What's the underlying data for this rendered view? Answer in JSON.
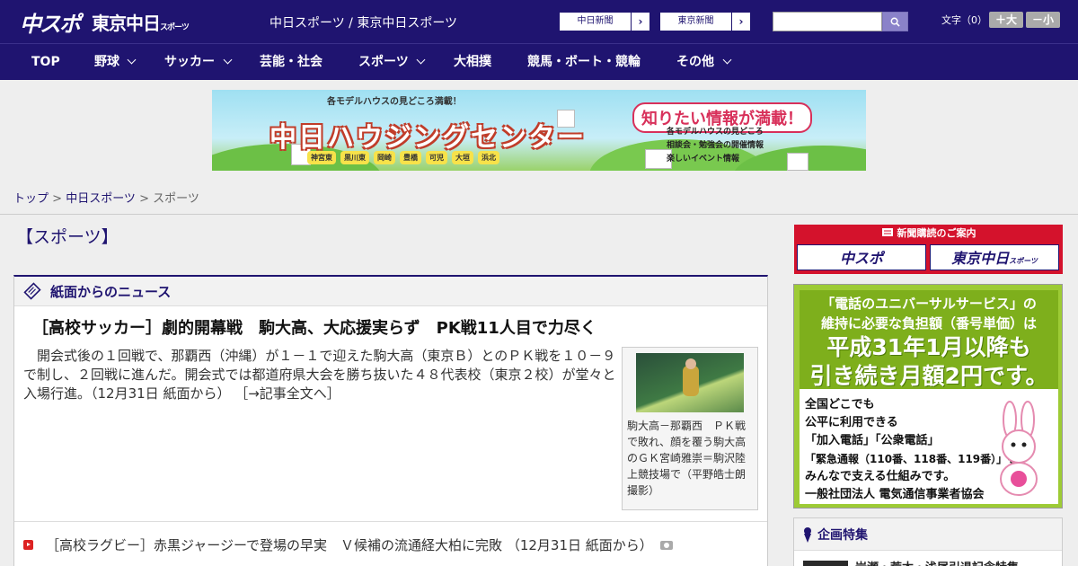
{
  "header": {
    "logo_main": "中スポ",
    "logo_sub": "東京中日",
    "logo_sub_small": "スポーツ",
    "site_names": "中日スポーツ / 東京中日スポーツ",
    "paper_links": [
      "中日新聞",
      "東京新聞"
    ],
    "font_size_label": "文字（0）",
    "font_up": "＋大",
    "font_down": "－小"
  },
  "nav": {
    "items": [
      "TOP",
      "野球",
      "サッカー",
      "芸能・社会",
      "スポーツ",
      "大相撲",
      "競馬・ボート・競輪",
      "その他"
    ]
  },
  "banner": {
    "top_text": "各モデルハウスの見どころ満載！",
    "title": "中日ハウジングセンター",
    "tag": "知りたい情報が満載！",
    "towns": [
      "神宮東",
      "黒川東",
      "岡崎",
      "豊橋",
      "可児",
      "大垣",
      "浜北"
    ],
    "info": [
      "各モデルハウスの見どころ",
      "相談会・勉強会の開催情報",
      "楽しいイベント情報"
    ]
  },
  "breadcrumb": {
    "home": "トップ",
    "parent": "中日スポーツ",
    "current": "スポーツ",
    "sep": " > "
  },
  "page_title": "【スポーツ】",
  "panel": {
    "heading": "紙面からのニュース",
    "lead_title": "［高校サッカー］劇的開幕戦　駒大高、大応援実らず　PK戦11人目で力尽く",
    "lead_body": "開会式後の１回戦で、那覇西（沖縄）が１－１で迎えた駒大高（東京Ｂ）とのＰＫ戦を１０－９で制し、２回戦に進んだ。開会式では都道府県大会を勝ち抜いた４８代表校（東京２校）が堂々と入場行進。（12月31日 紙面から）",
    "lead_link": "［→記事全文へ］",
    "photo_caption": "駒大高－那覇西　ＰＫ戦で敗れ、顔を覆う駒大高のＧＫ宮崎雅崇＝駒沢陸上競技場で（平野皓士朗撮影）",
    "list_item": "［高校ラグビー］赤黒ジャージーで登場の早実　Ｖ候補の流通経大柏に完敗 （12月31日 紙面から）"
  },
  "sidebar": {
    "subscribe_head": "新聞購読のご案内",
    "subscribe_buttons": [
      "中スポ",
      "東京中日"
    ],
    "subscribe_small": "スポーツ",
    "ad_lines": [
      "「電話のユニバーサルサービス」の",
      "維持に必要な負担額（番号単価）は",
      "平成31年1月以降も",
      "引き続き月額2円です。"
    ],
    "ad_body": [
      "全国どこでも",
      "公平に利用できる",
      "「加入電話」「公衆電話」",
      "「緊急通報（110番、118番、119番）」を",
      "みんなで支える仕組みです。",
      "一般社団法人 電気通信事業者協会"
    ],
    "feature_head": "企画特集",
    "feature_item": "岩瀬・荒木・浅尾引退記念特集"
  },
  "colors": {
    "brand_navy": "#1f1470",
    "subscribe_red": "#d4122c",
    "ad_green": "#9dcb35"
  }
}
